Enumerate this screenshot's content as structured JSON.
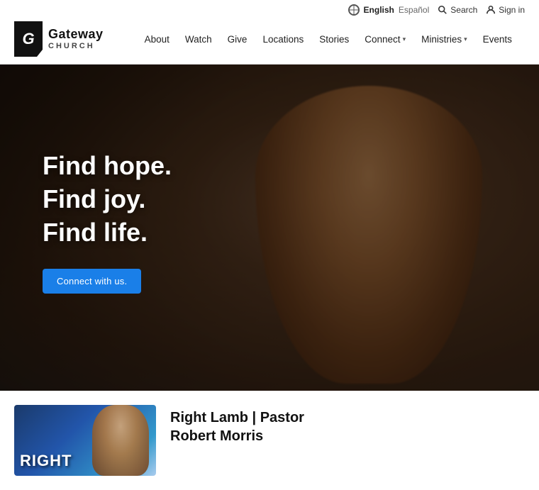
{
  "header": {
    "logo": {
      "icon_letter": "G",
      "name_line1": "Gateway",
      "name_line2": "CHURCH"
    },
    "topbar": {
      "english_label": "English",
      "espanol_label": "Español",
      "search_label": "Search",
      "signin_label": "Sign in"
    },
    "nav": {
      "items": [
        {
          "label": "About",
          "has_dropdown": false
        },
        {
          "label": "Watch",
          "has_dropdown": false
        },
        {
          "label": "Give",
          "has_dropdown": false
        },
        {
          "label": "Locations",
          "has_dropdown": false
        },
        {
          "label": "Stories",
          "has_dropdown": false
        },
        {
          "label": "Connect",
          "has_dropdown": true
        },
        {
          "label": "Ministries",
          "has_dropdown": true
        },
        {
          "label": "Events",
          "has_dropdown": false
        }
      ]
    }
  },
  "hero": {
    "headline_line1": "Find hope.",
    "headline_line2": "Find joy.",
    "headline_line3": "Find life.",
    "cta_label": "Connect with us."
  },
  "bottom": {
    "thumbnail_text": "RIGHT",
    "card_title_line1": "Right Lamb | Pastor",
    "card_title_line2": "Robert Morris"
  }
}
